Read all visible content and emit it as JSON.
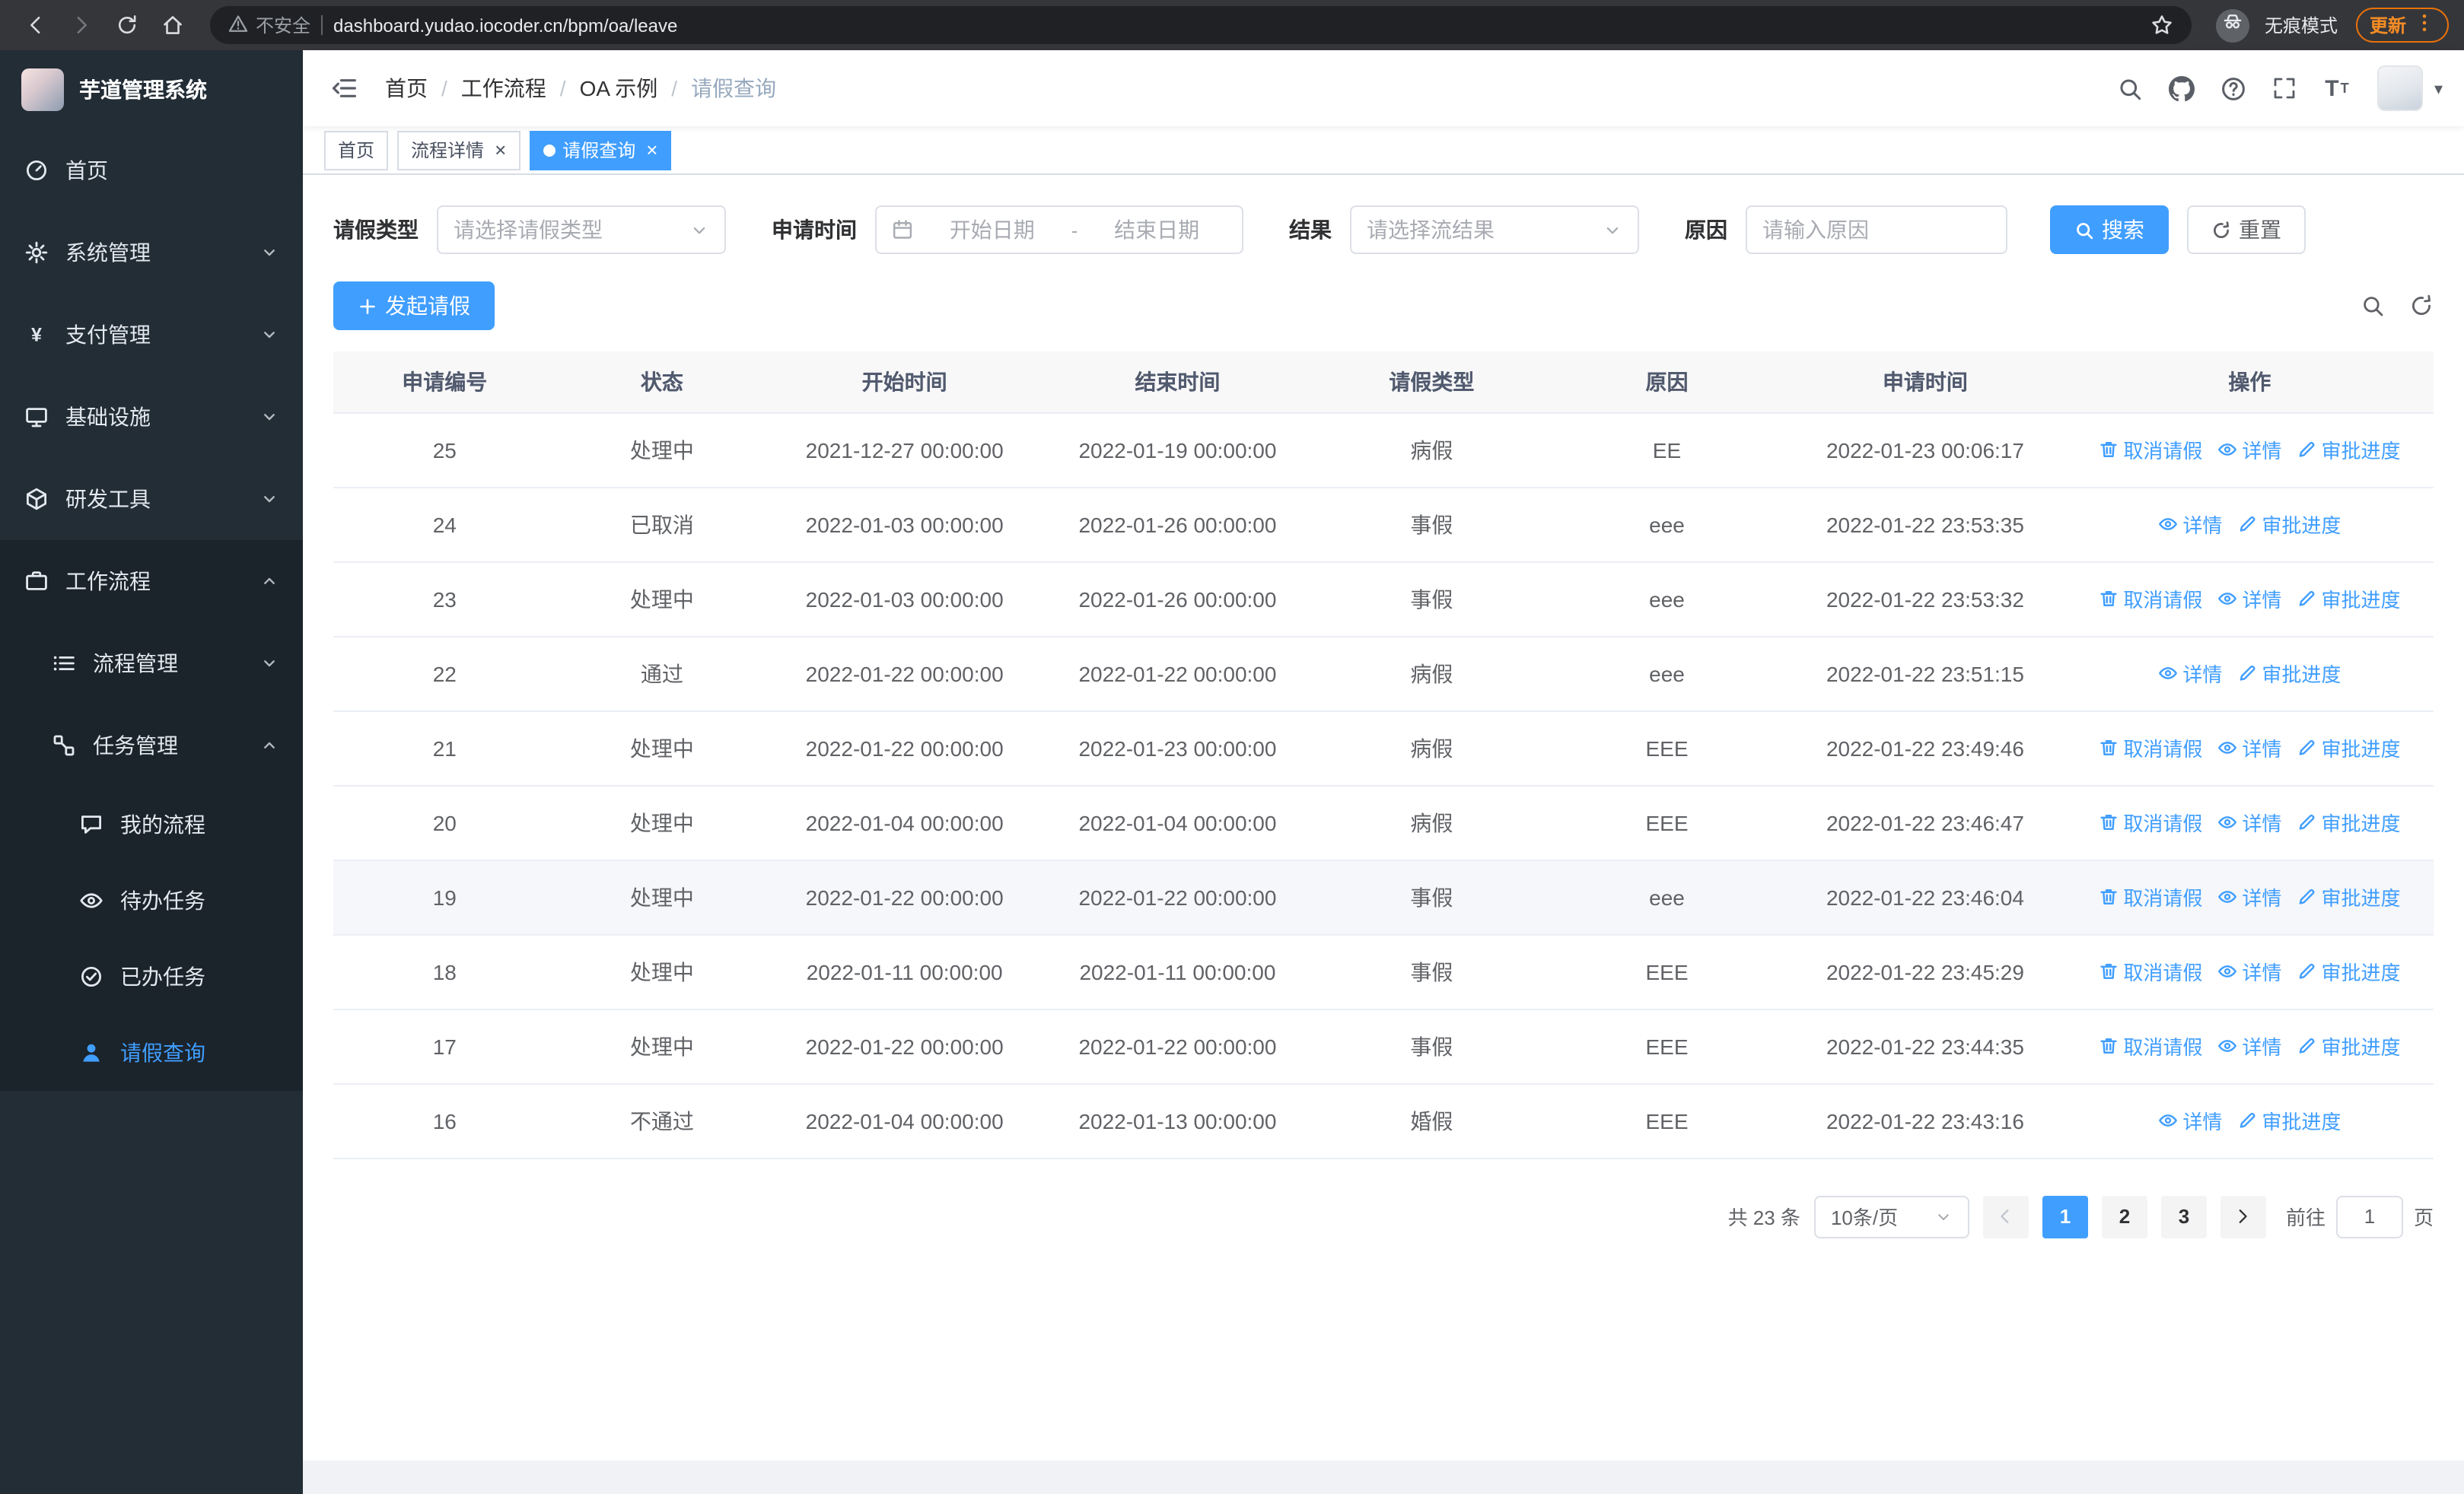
{
  "colors": {
    "primary": "#409eff",
    "sidebar_bg": "#232d36",
    "submenu_bg": "#1b232b"
  },
  "browser": {
    "security_label": "不安全",
    "url": "dashboard.yudao.iocoder.cn/bpm/oa/leave",
    "incognito_label": "无痕模式",
    "update_label": "更新"
  },
  "sidebar": {
    "app_title": "芋道管理系统",
    "menu": [
      {
        "name": "home",
        "label": "首页",
        "icon": "dashboard",
        "level": 1
      },
      {
        "name": "system",
        "label": "系统管理",
        "icon": "gear",
        "level": 1,
        "arrow": "down"
      },
      {
        "name": "payment",
        "label": "支付管理",
        "icon": "yen",
        "level": 1,
        "arrow": "down"
      },
      {
        "name": "infrastructure",
        "label": "基础设施",
        "icon": "infra",
        "level": 1,
        "arrow": "down"
      },
      {
        "name": "devtools",
        "label": "研发工具",
        "icon": "tools",
        "level": 1,
        "arrow": "down"
      },
      {
        "name": "workflow",
        "label": "工作流程",
        "icon": "briefcase",
        "level": 1,
        "arrow": "up",
        "dark": true
      },
      {
        "name": "process-mgmt",
        "label": "流程管理",
        "icon": "list",
        "level": 2,
        "arrow": "down",
        "dark": true
      },
      {
        "name": "task-mgmt",
        "label": "任务管理",
        "icon": "nodes",
        "level": 2,
        "arrow": "up",
        "dark": true
      },
      {
        "name": "my-process",
        "label": "我的流程",
        "icon": "chat",
        "level": 3,
        "dark": true
      },
      {
        "name": "todo-task",
        "label": "待办任务",
        "icon": "eye",
        "level": 3,
        "dark": true
      },
      {
        "name": "done-task",
        "label": "已办任务",
        "icon": "check",
        "level": 3,
        "dark": true
      },
      {
        "name": "leave-query",
        "label": "请假查询",
        "icon": "user",
        "level": 3,
        "dark": true,
        "active": true
      }
    ]
  },
  "header": {
    "breadcrumb": [
      "首页",
      "工作流程",
      "OA 示例",
      "请假查询"
    ]
  },
  "tabs": [
    {
      "name": "home",
      "label": "首页",
      "closable": false,
      "active": false
    },
    {
      "name": "process-detail",
      "label": "流程详情",
      "closable": true,
      "active": false
    },
    {
      "name": "leave-query",
      "label": "请假查询",
      "closable": true,
      "active": true
    }
  ],
  "filters": {
    "leave_type": {
      "label": "请假类型",
      "placeholder": "请选择请假类型"
    },
    "apply_time": {
      "label": "申请时间",
      "start_placeholder": "开始日期",
      "separator": "-",
      "end_placeholder": "结束日期"
    },
    "result": {
      "label": "结果",
      "placeholder": "请选择流结果"
    },
    "reason": {
      "label": "原因",
      "placeholder": "请输入原因"
    },
    "search_label": "搜索",
    "reset_label": "重置"
  },
  "toolbar": {
    "create_label": "发起请假"
  },
  "table": {
    "columns": [
      "申请编号",
      "状态",
      "开始时间",
      "结束时间",
      "请假类型",
      "原因",
      "申请时间",
      "操作"
    ],
    "actions": {
      "cancel": "取消请假",
      "detail": "详情",
      "progress": "审批进度"
    },
    "rows": [
      {
        "id": "25",
        "status": "处理中",
        "start": "2021-12-27 00:00:00",
        "end": "2022-01-19 00:00:00",
        "type": "病假",
        "reason": "EE",
        "apply_time": "2022-01-23 00:06:17",
        "cancellable": true,
        "hovered": false
      },
      {
        "id": "24",
        "status": "已取消",
        "start": "2022-01-03 00:00:00",
        "end": "2022-01-26 00:00:00",
        "type": "事假",
        "reason": "eee",
        "apply_time": "2022-01-22 23:53:35",
        "cancellable": false,
        "hovered": false
      },
      {
        "id": "23",
        "status": "处理中",
        "start": "2022-01-03 00:00:00",
        "end": "2022-01-26 00:00:00",
        "type": "事假",
        "reason": "eee",
        "apply_time": "2022-01-22 23:53:32",
        "cancellable": true,
        "hovered": false
      },
      {
        "id": "22",
        "status": "通过",
        "start": "2022-01-22 00:00:00",
        "end": "2022-01-22 00:00:00",
        "type": "病假",
        "reason": "eee",
        "apply_time": "2022-01-22 23:51:15",
        "cancellable": false,
        "hovered": false
      },
      {
        "id": "21",
        "status": "处理中",
        "start": "2022-01-22 00:00:00",
        "end": "2022-01-23 00:00:00",
        "type": "病假",
        "reason": "EEE",
        "apply_time": "2022-01-22 23:49:46",
        "cancellable": true,
        "hovered": false
      },
      {
        "id": "20",
        "status": "处理中",
        "start": "2022-01-04 00:00:00",
        "end": "2022-01-04 00:00:00",
        "type": "病假",
        "reason": "EEE",
        "apply_time": "2022-01-22 23:46:47",
        "cancellable": true,
        "hovered": false
      },
      {
        "id": "19",
        "status": "处理中",
        "start": "2022-01-22 00:00:00",
        "end": "2022-01-22 00:00:00",
        "type": "事假",
        "reason": "eee",
        "apply_time": "2022-01-22 23:46:04",
        "cancellable": true,
        "hovered": true
      },
      {
        "id": "18",
        "status": "处理中",
        "start": "2022-01-11 00:00:00",
        "end": "2022-01-11 00:00:00",
        "type": "事假",
        "reason": "EEE",
        "apply_time": "2022-01-22 23:45:29",
        "cancellable": true,
        "hovered": false
      },
      {
        "id": "17",
        "status": "处理中",
        "start": "2022-01-22 00:00:00",
        "end": "2022-01-22 00:00:00",
        "type": "事假",
        "reason": "EEE",
        "apply_time": "2022-01-22 23:44:35",
        "cancellable": true,
        "hovered": false
      },
      {
        "id": "16",
        "status": "不通过",
        "start": "2022-01-04 00:00:00",
        "end": "2022-01-13 00:00:00",
        "type": "婚假",
        "reason": "EEE",
        "apply_time": "2022-01-22 23:43:16",
        "cancellable": false,
        "hovered": false
      }
    ]
  },
  "pagination": {
    "total": "共 23 条",
    "page_size": "10条/页",
    "pages": [
      "1",
      "2",
      "3"
    ],
    "active_page": "1",
    "prev_disabled": true,
    "goto_label": "前往",
    "goto_value": "1",
    "unit_label": "页"
  }
}
